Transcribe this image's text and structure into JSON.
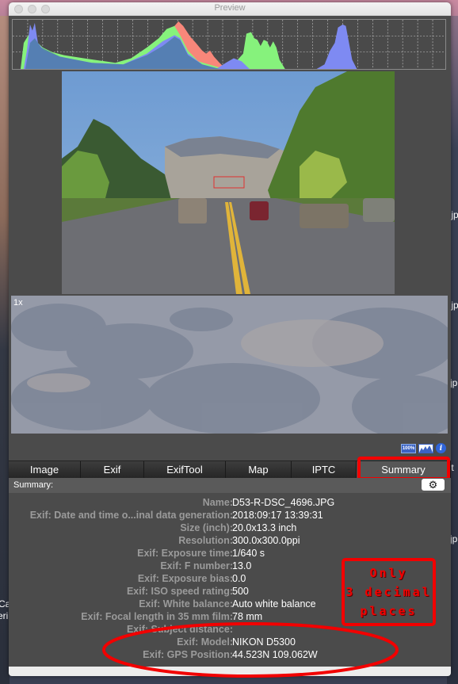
{
  "window": {
    "title": "Preview"
  },
  "desktop": {
    "right_labels": [
      ".jp",
      ".jp",
      "jp",
      ".t",
      "jp"
    ],
    "left_labels": [
      "Ca",
      "eri"
    ]
  },
  "zoom_view": {
    "label": "1x"
  },
  "toolbar_icons": {
    "zoom_100": "100%",
    "histogram": "histogram-icon",
    "info": "i"
  },
  "tabs": [
    {
      "label": "Image",
      "active": false
    },
    {
      "label": "Exif",
      "active": false
    },
    {
      "label": "ExifTool",
      "active": false
    },
    {
      "label": "Map",
      "active": false
    },
    {
      "label": "IPTC",
      "active": false
    },
    {
      "label": "Summary",
      "active": true
    }
  ],
  "summary": {
    "header": "Summary:",
    "settings_icon": "gear-icon",
    "rows": [
      {
        "key": "Name:",
        "value": "D53-R-DSC_4696.JPG"
      },
      {
        "key": "Exif: Date and time o...inal data generation:",
        "value": "2018:09:17 13:39:31"
      },
      {
        "key": "Size (inch):",
        "value": "20.0x13.3 inch"
      },
      {
        "key": "Resolution:",
        "value": "300.0x300.0ppi"
      },
      {
        "key": "Exif: Exposure time:",
        "value": "1/640 s"
      },
      {
        "key": "Exif: F number:",
        "value": "13.0"
      },
      {
        "key": "Exif: Exposure bias:",
        "value": "0.0"
      },
      {
        "key": "Exif: ISO speed rating:",
        "value": "500"
      },
      {
        "key": "Exif: White balance:",
        "value": "Auto white balance"
      },
      {
        "key": "Exif: Focal length in 35 mm film:",
        "value": "78 mm"
      },
      {
        "key": "Exif: Subject distance:",
        "value": ""
      },
      {
        "key": "Exif: Model:",
        "value": "NIKON D5300"
      },
      {
        "key": "Exif: GPS Position:",
        "value": " 44.523N 109.062W"
      }
    ]
  },
  "annotation": {
    "lines": [
      "Only",
      "3 decimal",
      "places"
    ],
    "color": "#f20000"
  }
}
